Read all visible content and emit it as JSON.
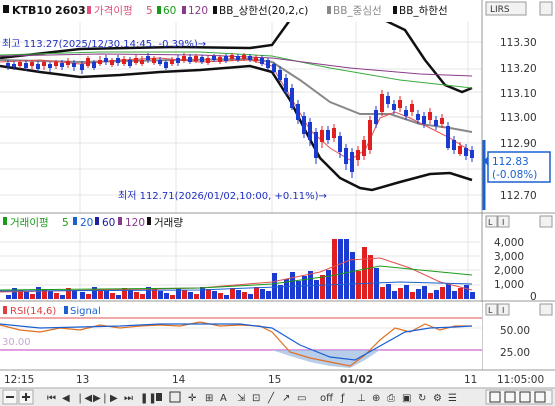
{
  "symbol": "KTB10",
  "contract": "2603",
  "price_panel": {
    "legend": [
      {
        "label": "가격이평",
        "color": "#e0507a"
      },
      {
        "label": "5",
        "color": "#e0507a"
      },
      {
        "label": "60",
        "color": "#1a9a1a"
      },
      {
        "label": "120",
        "color": "#8a3a8a"
      },
      {
        "label": "BB_상한선(20,2,c)",
        "color": "#111"
      },
      {
        "label": "BB_중심선",
        "color": "#888"
      },
      {
        "label": "BB_하한선",
        "color": "#111"
      }
    ],
    "high_annotation": "최고 113.27(2025/12/30,14:45, -0.39%)→",
    "low_annotation": "최저 112.71(2026/01/02,10:00, +0.11%)→",
    "y_ticks": [
      "113.30",
      "113.20",
      "113.10",
      "113.00",
      "112.90",
      "112.70"
    ],
    "current_price": "112.83",
    "current_change": "(-0.08%)",
    "top_right_label": "LIRS"
  },
  "volume_panel": {
    "legend": [
      {
        "label": "거래이평",
        "color": "#1a9a1a"
      },
      {
        "label": "5",
        "color": "#1a9a1a"
      },
      {
        "label": "20",
        "color": "#1a60d0"
      },
      {
        "label": "60",
        "color": "#2020a0"
      },
      {
        "label": "120",
        "color": "#8a3a8a"
      },
      {
        "label": "거래량",
        "color": "#111"
      }
    ],
    "y_ticks": [
      "4,000",
      "3,000",
      "2,000",
      "1,000",
      "0"
    ]
  },
  "rsi_panel": {
    "legend": [
      {
        "label": "RSI(14,6)",
        "color": "#e04040"
      },
      {
        "label": "Signal",
        "color": "#1a60d0"
      }
    ],
    "level_label": "30.00",
    "y_ticks": [
      "50.00",
      "25.00"
    ]
  },
  "time_axis": {
    "labels": [
      "12:15",
      "13",
      "14",
      "15",
      "01/02",
      "11"
    ],
    "current_time": "11:05:00"
  },
  "toolbar": {
    "offset_label": "off"
  },
  "side_buttons": [
    "L",
    "I"
  ]
}
